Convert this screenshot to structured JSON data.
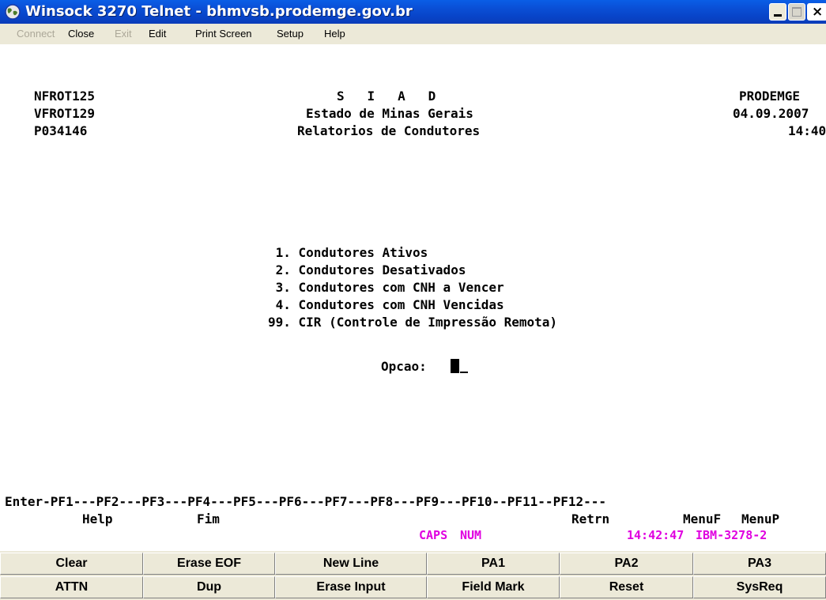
{
  "window": {
    "title": "Winsock 3270 Telnet - bhmvsb.prodemge.gov.br",
    "icon": "globe-icon"
  },
  "menu": [
    {
      "label": "Connect",
      "enabled": false
    },
    {
      "label": "Close",
      "enabled": true
    },
    {
      "label": "Exit",
      "enabled": false
    },
    {
      "label": "Edit",
      "enabled": true
    },
    {
      "label": "Print Screen",
      "enabled": true
    },
    {
      "label": "Setup",
      "enabled": true
    },
    {
      "label": "Help",
      "enabled": true
    }
  ],
  "screen": {
    "header": {
      "left": [
        "NFROT125",
        "VFROT129",
        "P034146"
      ],
      "center": [
        "S   I   A   D",
        "Estado de Minas Gerais",
        "Relatorios de Condutores"
      ],
      "right": [
        "PRODEMGE",
        "04.09.2007",
        "14:40"
      ]
    },
    "options": [
      " 1. Condutores Ativos",
      " 2. Condutores Desativados",
      " 3. Condutores com CNH a Vencer",
      " 4. Condutores com CNH Vencidas",
      "99. CIR (Controle de Impressão Remota)"
    ],
    "prompt_label": "Opcao:",
    "pf_keys_line": "Enter-PF1---PF2---PF3---PF4---PF5---PF6---PF7---PF8---PF9---PF10--PF11--PF12---",
    "pf_labels": {
      "pf1": "Help",
      "pf3": "Fim",
      "pf9": "Retrn",
      "pf11": "MenuF",
      "pf12": "MenuP"
    },
    "status": {
      "caps": "CAPS",
      "num": "NUM",
      "time": "14:42:47",
      "terminal_type": "IBM-3278-2",
      "color": "#e000e0"
    }
  },
  "keypad": {
    "row1": [
      "Clear",
      "Erase EOF",
      "New Line",
      "PA1",
      "PA2",
      "PA3"
    ],
    "row2": [
      "ATTN",
      "Dup",
      "Erase Input",
      "Field Mark",
      "Reset",
      "SysReq"
    ]
  }
}
